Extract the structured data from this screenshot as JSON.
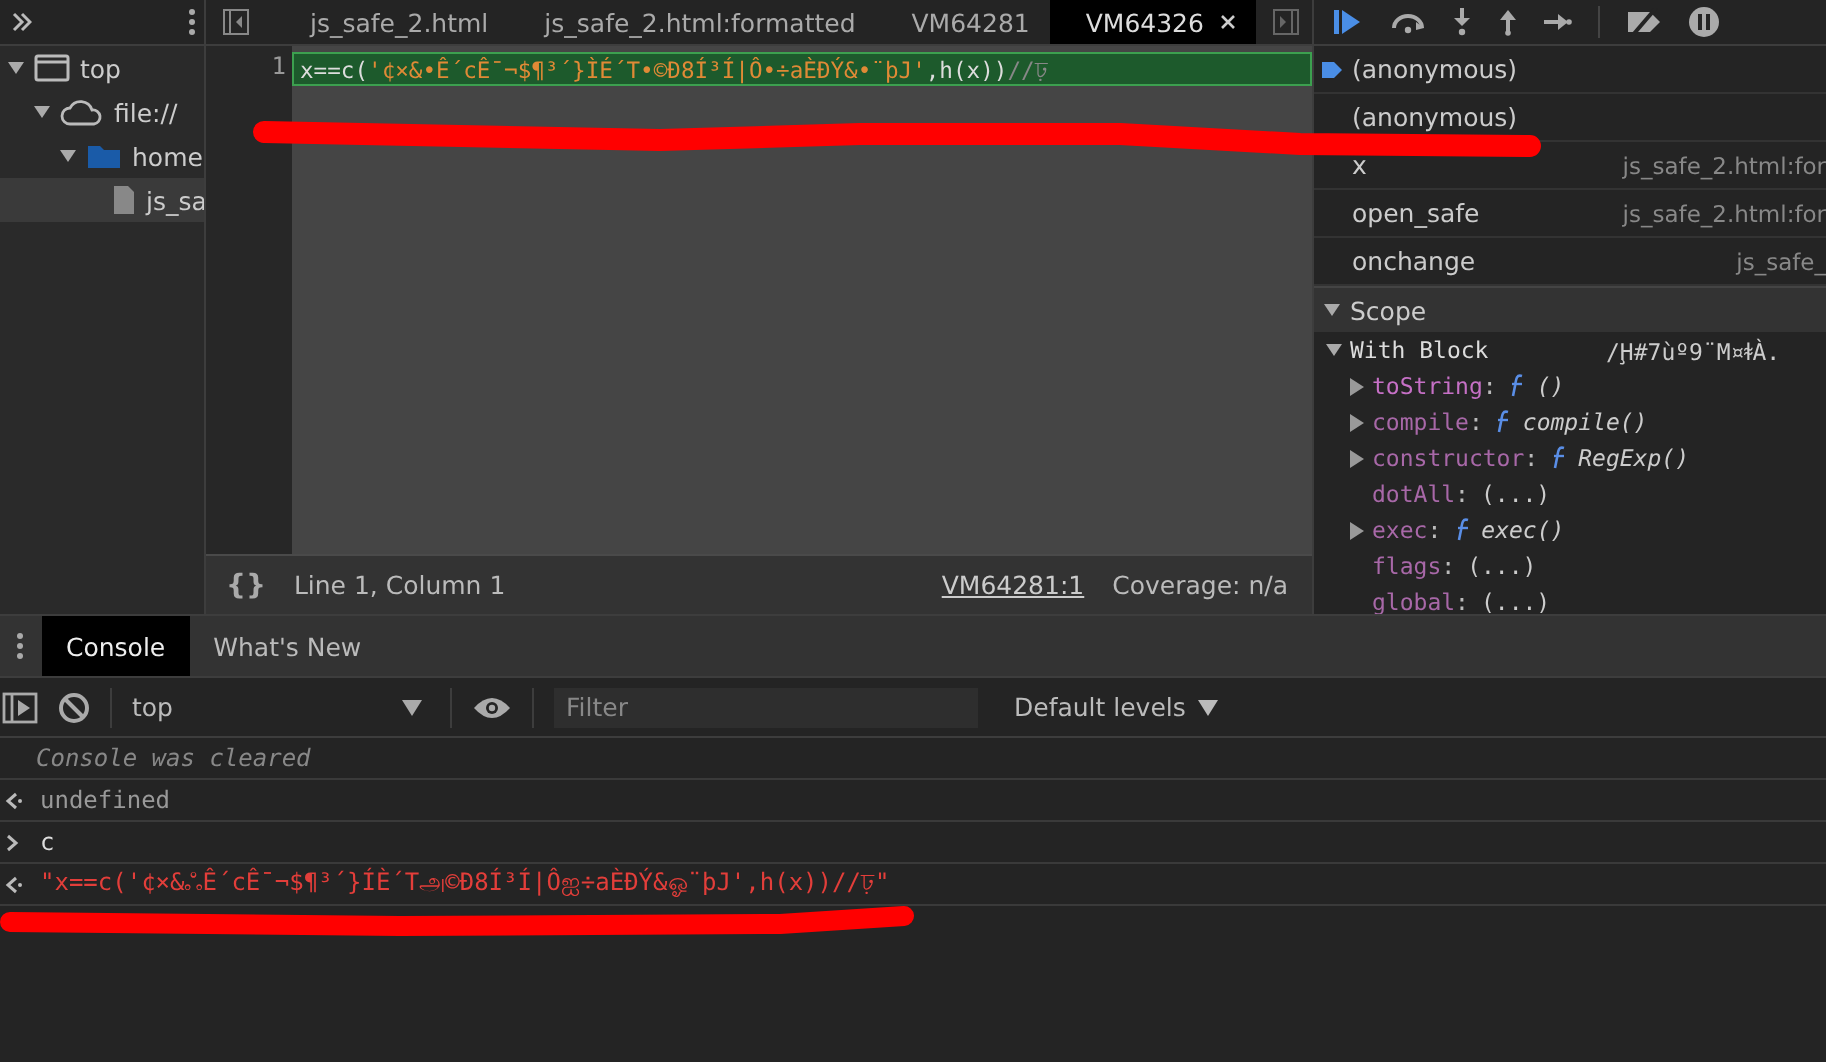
{
  "navigator": {
    "tree": [
      {
        "label": "top",
        "kind": "frame",
        "expanded": true,
        "selected": false,
        "children": [
          {
            "label": "file://",
            "kind": "cloud",
            "expanded": true,
            "selected": false,
            "children": [
              {
                "label": "home",
                "kind": "folder",
                "expanded": true,
                "selected": false,
                "children": [
                  {
                    "label": "js_sa",
                    "kind": "file",
                    "selected": true
                  }
                ]
              }
            ]
          }
        ]
      }
    ]
  },
  "editor_tabs": [
    {
      "label": "js_safe_2.html",
      "selected": false
    },
    {
      "label": "js_safe_2.html:formatted",
      "selected": false
    },
    {
      "label": "VM64281",
      "selected": false
    },
    {
      "label": "VM64326",
      "selected": true,
      "closable": true
    }
  ],
  "editor": {
    "lines": [
      {
        "number": "1",
        "text": "x==c('¢×&•Ê´cÊ¯¬$¶³´}ÌÉ´T•©Ð8Í³Í|Ô•÷aÈÐÝ&•¨þJ',h(x))//ঢ়",
        "highlighted": true
      }
    ],
    "format_button": "{}",
    "status": "Line 1, Column 1",
    "source_link": "VM64281:1",
    "coverage": "Coverage: n/a"
  },
  "call_stack": [
    {
      "name": "(anonymous)",
      "current": true
    },
    {
      "name": "(anonymous)",
      "current": false
    },
    {
      "name": "x",
      "location": "js_safe_2.html:for",
      "current": false
    },
    {
      "name": "open_safe",
      "location": "js_safe_2.html:for",
      "current": false
    },
    {
      "name": "onchange",
      "location": "js_safe_",
      "current": false
    }
  ],
  "scope": {
    "title": "Scope",
    "expanded": true,
    "block": {
      "label": "With Block",
      "value": "/Ḩ#7ùº9¨M¤ꬸÀ.",
      "expanded": true
    },
    "properties": [
      {
        "kind": "function",
        "name": "toString",
        "separator": ":",
        "signature": "()",
        "expandable": true,
        "own": true
      },
      {
        "kind": "function",
        "name": "compile",
        "separator": ":",
        "signature": "compile()",
        "expandable": true,
        "own": false
      },
      {
        "kind": "function",
        "name": "constructor",
        "separator": ":",
        "signature": "RegExp()",
        "expandable": true,
        "own": false
      },
      {
        "kind": "getter",
        "name": "dotAll",
        "separator": ":",
        "signature": "(...)",
        "expandable": false,
        "own": false
      },
      {
        "kind": "function",
        "name": "exec",
        "separator": ":",
        "signature": "exec()",
        "expandable": true,
        "own": false
      },
      {
        "kind": "getter",
        "name": "flags",
        "separator": ":",
        "signature": "(...)",
        "expandable": false,
        "own": false
      },
      {
        "kind": "getter",
        "name": "global",
        "separator": ":",
        "signature": "(...)",
        "expandable": false,
        "own": false
      }
    ]
  },
  "drawer_tabs": [
    {
      "label": "Console",
      "selected": true
    },
    {
      "label": "What's New",
      "selected": false
    }
  ],
  "console_toolbar": {
    "context": "top",
    "filter_placeholder": "Filter",
    "levels": "Default levels"
  },
  "console": [
    {
      "kind": "info",
      "text": "Console was cleared"
    },
    {
      "kind": "result",
      "text": "undefined"
    },
    {
      "kind": "input",
      "text": "c"
    },
    {
      "kind": "string",
      "text": "\"x==c('¢×&ஃÊ´cÊ¯¬$¶³´}ÍÈ´Tஅ©Ð8Í³Í|Ôஐ÷aÈÐÝ&ஓ¨þJ',h(x))//ঢ়\""
    }
  ]
}
